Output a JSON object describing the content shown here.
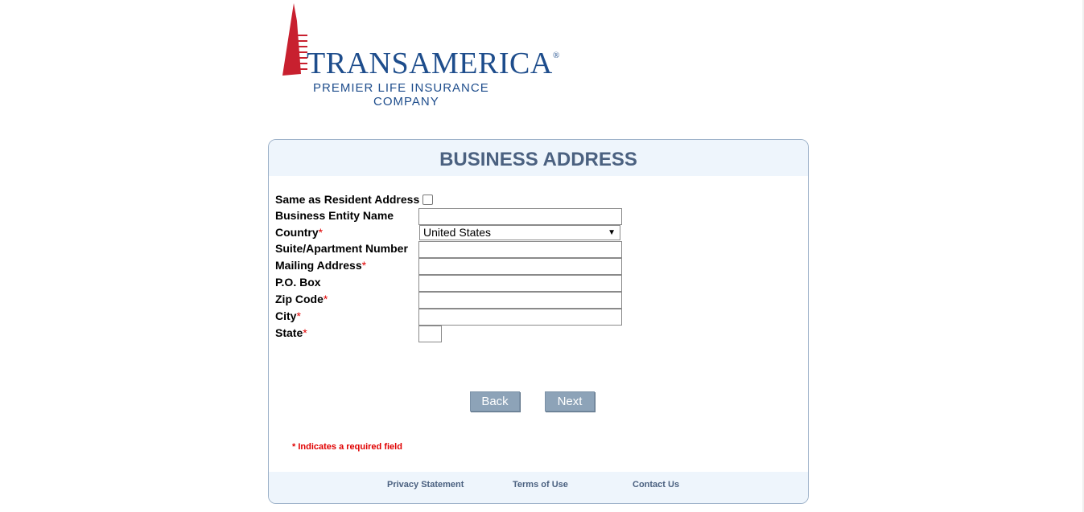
{
  "logo": {
    "name": "TRANSAMERICA",
    "registered": "®",
    "line1": "PREMIER LIFE INSURANCE",
    "line2": "COMPANY",
    "brand_color": "#1e4d8c",
    "tower_color": "#c8202f"
  },
  "form": {
    "title": "BUSINESS ADDRESS",
    "same_as_resident_label": "Same as Resident Address",
    "same_as_resident_checked": false,
    "fields": {
      "business_entity_name": {
        "label": "Business Entity Name",
        "value": ""
      },
      "country": {
        "label": "Country",
        "value": "United States"
      },
      "suite": {
        "label": "Suite/Apartment Number",
        "value": ""
      },
      "mailing_address": {
        "label": "Mailing Address",
        "value": ""
      },
      "po_box": {
        "label": "P.O. Box",
        "value": ""
      },
      "zip": {
        "label": "Zip Code",
        "value": ""
      },
      "city": {
        "label": "City",
        "value": ""
      },
      "state": {
        "label": "State",
        "value": ""
      }
    },
    "required_mark": "*",
    "back_label": "Back",
    "next_label": "Next",
    "required_note": "* Indicates a required field"
  },
  "footer": {
    "privacy": "Privacy Statement",
    "terms": "Terms of Use",
    "contact": "Contact Us"
  },
  "colors": {
    "title": "#4b6180",
    "header_bg": "#eef5fc",
    "button_bg": "#8da3b8",
    "required": "#e00000"
  }
}
